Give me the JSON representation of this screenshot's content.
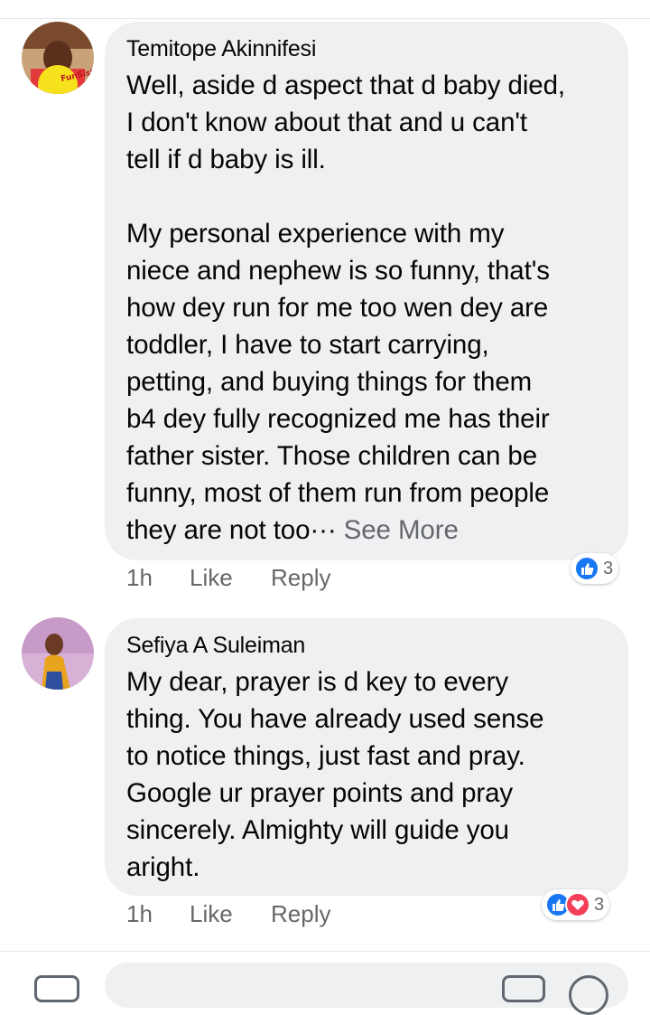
{
  "comments": [
    {
      "author": "Temitope Akinnifesi",
      "text": "Well, aside d aspect that d baby died,\nI don't know about that and u can't\ntell if d baby is ill.\n\nMy personal experience with my\nniece and nephew is so funny, that's\nhow dey run for me too wen dey are\ntoddler, I have to start carrying,\npetting, and buying things for them\nb4 dey fully recognized me has their\nfather sister. Those children can be\nfunny, most of them run from people\nthey are not too··· ",
      "see_more": "See More",
      "time": "1h",
      "like": "Like",
      "reply": "Reply",
      "reaction_count": "3",
      "reactions": [
        "like-icon"
      ],
      "avatar_badge": "Fun Sister"
    },
    {
      "author": "Sefiya A Suleiman",
      "text": "My dear, prayer is d key to every\nthing. You have already used sense\nto notice things, just fast and pray.\nGoogle ur prayer points and pray\nsincerely. Almighty will guide you\naright.",
      "time": "1h",
      "like": "Like",
      "reply": "Reply",
      "reaction_count": "3",
      "reactions": [
        "like-icon",
        "love-icon"
      ]
    }
  ],
  "colors": {
    "bubble": "#eef0f1",
    "meta_text": "#65676b",
    "like_blue": "#1877f2",
    "love_red": "#f33e58"
  }
}
